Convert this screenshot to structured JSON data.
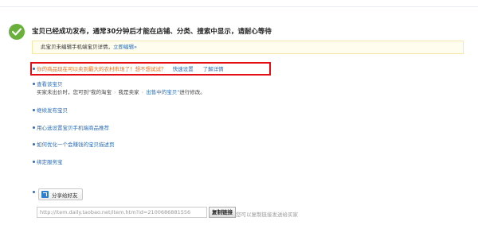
{
  "header": {
    "title": "宝贝已经成功发布，通常30分钟后才能在店铺、分类、搜索中显示，请耐心等待",
    "icon": "checkmark-success-icon",
    "icon_color": "#6ab03c"
  },
  "notice": {
    "text": "此宝贝未编辑手机端宝贝详情，",
    "link": "立即编辑»"
  },
  "promo": {
    "text": "你的商品现在可以卖到最大的农村市场了！想不想试试？",
    "quick_setup": "快速设置",
    "learn_more": "了解详情",
    "highlight_color": "#e40f14"
  },
  "view_item": {
    "title": "查看该宝贝",
    "desc_prefix": "买家未出价时，您可到\"我的淘宝",
    "crumb_1": "我是卖家",
    "crumb_2": "出售中的宝贝\"",
    "desc_suffix": "进行修改。"
  },
  "links": {
    "continue_publish": "继续发布宝贝",
    "mobile_recommend": "用心选设置宝贝手机端商品推荐",
    "optimize_detail": "如何优化一个会赚钱的宝贝描述页",
    "bind_service": "绑定服务宝"
  },
  "share": {
    "button_label": "分享给好友",
    "url_value": "http://item.daily.taobao.net/item.htm?id=2100686881556",
    "copy_label": "复制链接",
    "copy_hint": "您可以复制链接发送给买家"
  }
}
